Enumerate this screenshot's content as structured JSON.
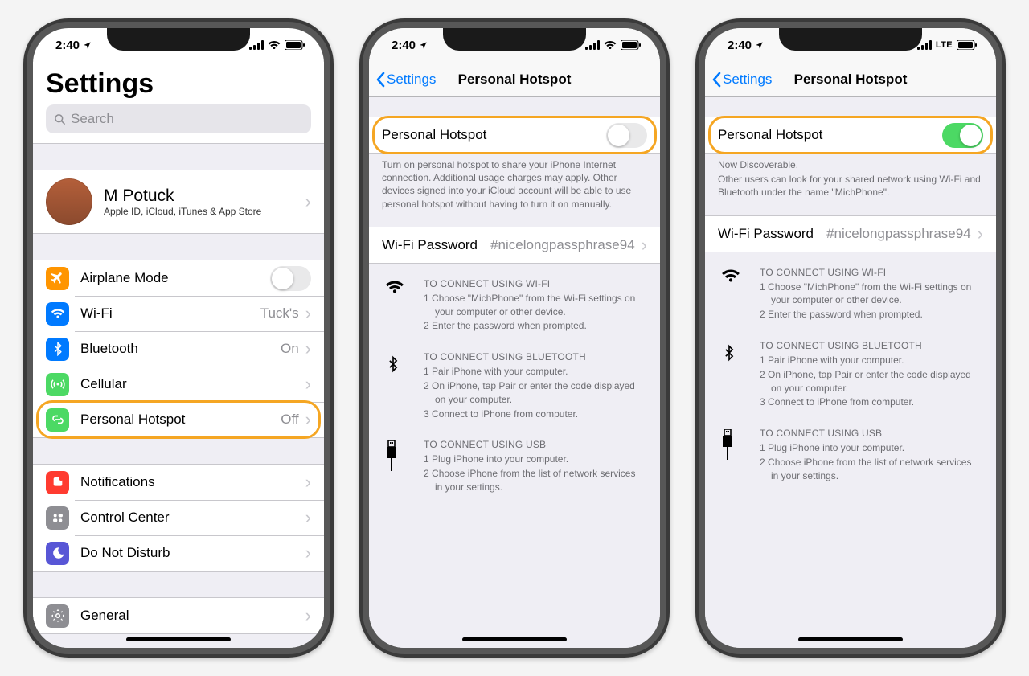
{
  "status": {
    "time": "2:40",
    "signal": "4",
    "lte": "LTE"
  },
  "screen1": {
    "title": "Settings",
    "search_placeholder": "Search",
    "profile": {
      "name": "M Potuck",
      "sub": "Apple ID, iCloud, iTunes & App Store"
    },
    "rows": {
      "airplane": "Airplane Mode",
      "wifi": "Wi-Fi",
      "wifi_val": "Tuck's",
      "bt": "Bluetooth",
      "bt_val": "On",
      "cellular": "Cellular",
      "hotspot": "Personal Hotspot",
      "hotspot_val": "Off",
      "notifications": "Notifications",
      "control": "Control Center",
      "dnd": "Do Not Disturb",
      "general": "General"
    }
  },
  "hotspot": {
    "back": "Settings",
    "title": "Personal Hotspot",
    "toggle_label": "Personal Hotspot",
    "off_note": "Turn on personal hotspot to share your iPhone Internet connection. Additional usage charges may apply. Other devices signed into your iCloud account will be able to use personal hotspot without having to turn it on manually.",
    "on_note1": "Now Discoverable.",
    "on_note2": "Other users can look for your shared network using Wi-Fi and Bluetooth under the name \"MichPhone\".",
    "pw_label": "Wi-Fi Password",
    "pw_value": "#nicelongpassphrase94",
    "wifi_title": "TO CONNECT USING WI-FI",
    "wifi_step1": "Choose \"MichPhone\" from the Wi-Fi settings on your computer or other device.",
    "wifi_step2": "Enter the password when prompted.",
    "bt_title": "TO CONNECT USING BLUETOOTH",
    "bt_step1": "Pair iPhone with your computer.",
    "bt_step2": "On iPhone, tap Pair or enter the code displayed on your computer.",
    "bt_step3": "Connect to iPhone from computer.",
    "usb_title": "TO CONNECT USING USB",
    "usb_step1": "Plug iPhone into your computer.",
    "usb_step2": "Choose iPhone from the list of network services in your settings."
  }
}
